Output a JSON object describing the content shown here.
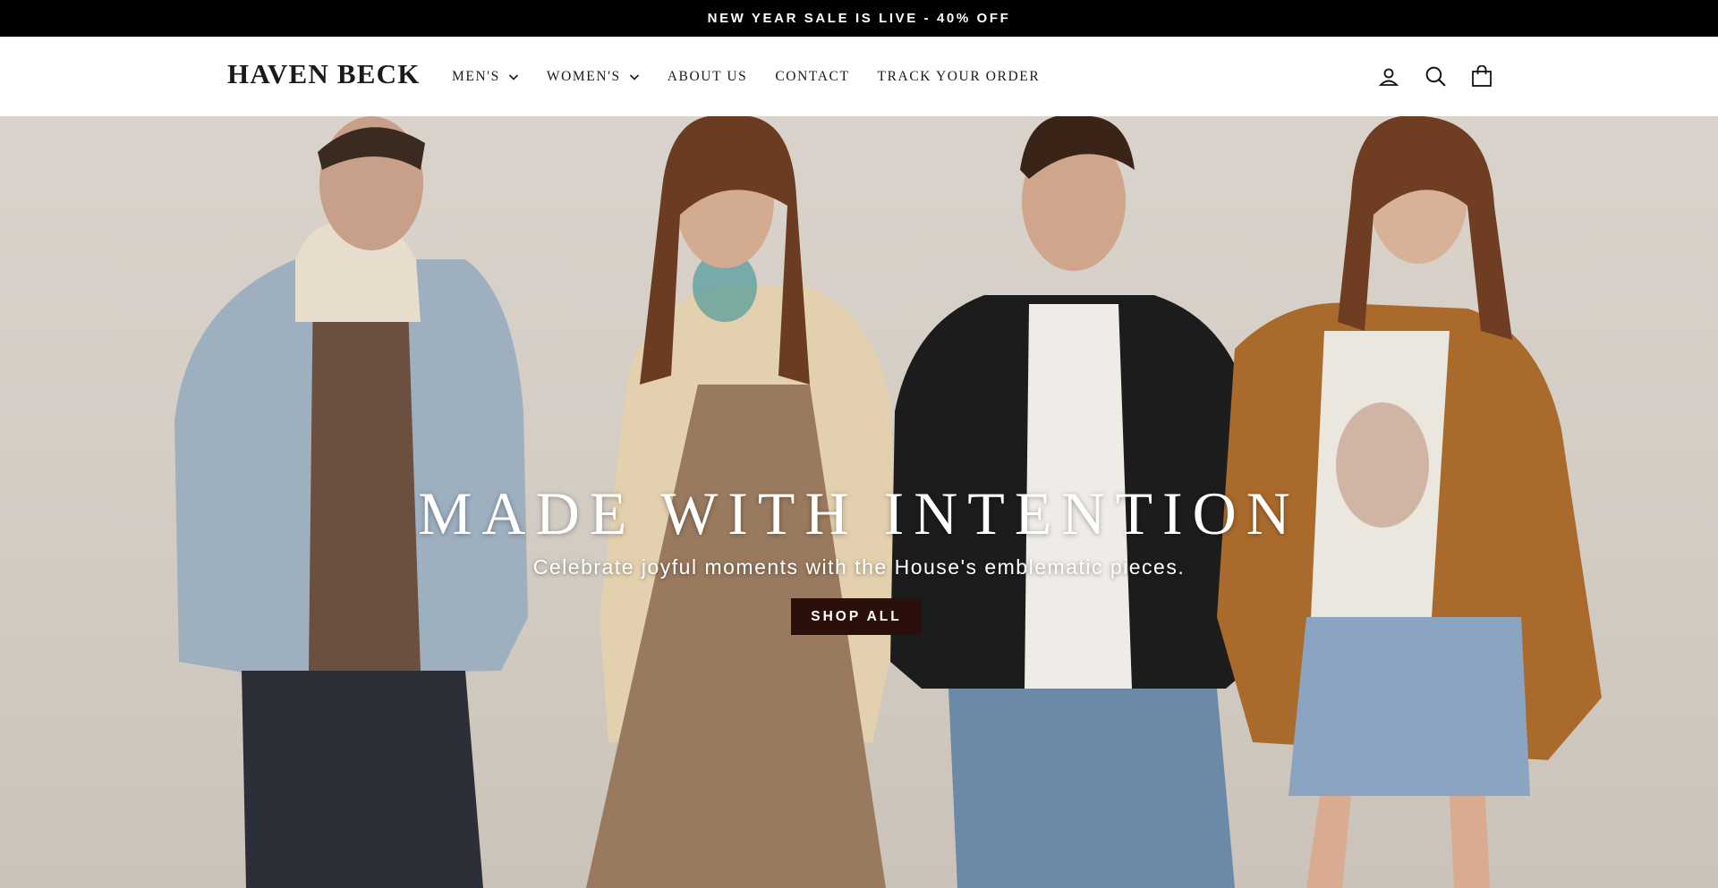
{
  "announcement": {
    "text": "NEW YEAR SALE IS LIVE - 40% OFF"
  },
  "header": {
    "logo": "HAVEN BECK",
    "nav": [
      {
        "label": "MEN'S",
        "has_dropdown": true
      },
      {
        "label": "WOMEN'S",
        "has_dropdown": true
      },
      {
        "label": "ABOUT US",
        "has_dropdown": false
      },
      {
        "label": "CONTACT",
        "has_dropdown": false
      },
      {
        "label": "TRACK YOUR ORDER",
        "has_dropdown": false
      }
    ],
    "icons": [
      "account-icon",
      "search-icon",
      "cart-icon"
    ]
  },
  "hero": {
    "title": "MADE WITH INTENTION",
    "subtitle": "Celebrate joyful moments with the House's emblematic pieces.",
    "cta": "SHOP ALL"
  },
  "colors": {
    "announcement_bg": "#000000",
    "cta_bg": "#2a0f0b",
    "hero_bg": "#d6cfc6"
  }
}
